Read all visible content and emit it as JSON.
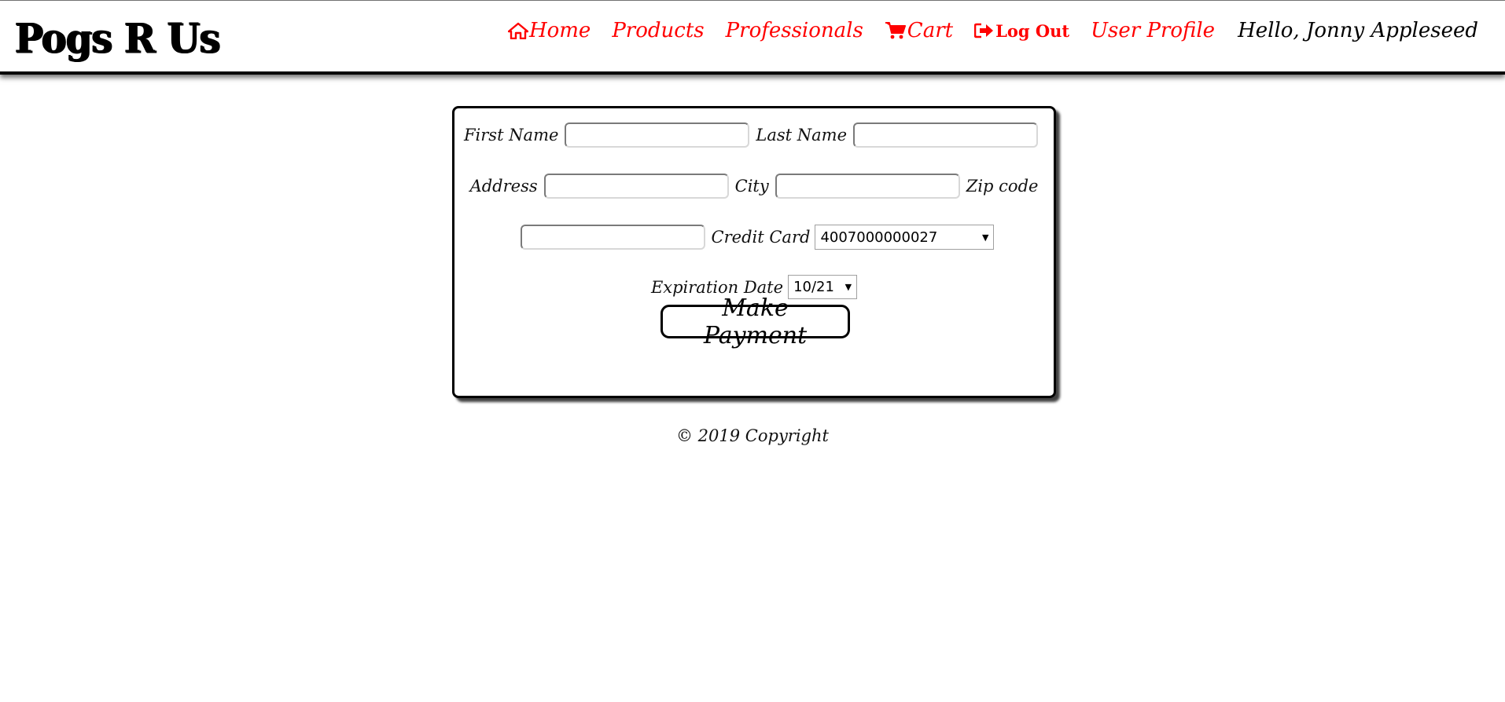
{
  "brand": {
    "logo_text": "Pogs R Us"
  },
  "nav": {
    "home": {
      "label": "Home",
      "icon": "home-icon"
    },
    "products": {
      "label": "Products"
    },
    "professionals": {
      "label": "Professionals"
    },
    "cart": {
      "label": "Cart",
      "icon": "cart-icon"
    },
    "logout": {
      "label": "Log Out",
      "icon": "sign-out-icon"
    },
    "profile": {
      "label": "User Profile"
    },
    "greeting": "Hello, Jonny Appleseed",
    "link_color": "#ff0000"
  },
  "form": {
    "first_name": {
      "label": "First Name",
      "value": ""
    },
    "last_name": {
      "label": "Last Name",
      "value": ""
    },
    "address": {
      "label": "Address",
      "value": ""
    },
    "city": {
      "label": "City",
      "value": ""
    },
    "zip": {
      "label": "Zip code",
      "value": ""
    },
    "credit_card": {
      "label": "Credit Card",
      "selected": "4007000000027"
    },
    "expiration": {
      "label": "Expiration Date",
      "selected": "10/21"
    },
    "submit_label": "Make Payment"
  },
  "footer": {
    "copyright": "© 2019 Copyright"
  }
}
